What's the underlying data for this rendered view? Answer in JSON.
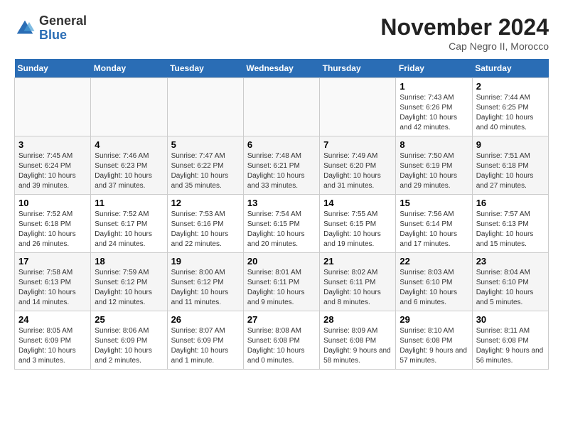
{
  "header": {
    "logo_general": "General",
    "logo_blue": "Blue",
    "month_title": "November 2024",
    "location": "Cap Negro II, Morocco"
  },
  "days_of_week": [
    "Sunday",
    "Monday",
    "Tuesday",
    "Wednesday",
    "Thursday",
    "Friday",
    "Saturday"
  ],
  "weeks": [
    [
      {
        "day": "",
        "info": ""
      },
      {
        "day": "",
        "info": ""
      },
      {
        "day": "",
        "info": ""
      },
      {
        "day": "",
        "info": ""
      },
      {
        "day": "",
        "info": ""
      },
      {
        "day": "1",
        "info": "Sunrise: 7:43 AM\nSunset: 6:26 PM\nDaylight: 10 hours and 42 minutes."
      },
      {
        "day": "2",
        "info": "Sunrise: 7:44 AM\nSunset: 6:25 PM\nDaylight: 10 hours and 40 minutes."
      }
    ],
    [
      {
        "day": "3",
        "info": "Sunrise: 7:45 AM\nSunset: 6:24 PM\nDaylight: 10 hours and 39 minutes."
      },
      {
        "day": "4",
        "info": "Sunrise: 7:46 AM\nSunset: 6:23 PM\nDaylight: 10 hours and 37 minutes."
      },
      {
        "day": "5",
        "info": "Sunrise: 7:47 AM\nSunset: 6:22 PM\nDaylight: 10 hours and 35 minutes."
      },
      {
        "day": "6",
        "info": "Sunrise: 7:48 AM\nSunset: 6:21 PM\nDaylight: 10 hours and 33 minutes."
      },
      {
        "day": "7",
        "info": "Sunrise: 7:49 AM\nSunset: 6:20 PM\nDaylight: 10 hours and 31 minutes."
      },
      {
        "day": "8",
        "info": "Sunrise: 7:50 AM\nSunset: 6:19 PM\nDaylight: 10 hours and 29 minutes."
      },
      {
        "day": "9",
        "info": "Sunrise: 7:51 AM\nSunset: 6:18 PM\nDaylight: 10 hours and 27 minutes."
      }
    ],
    [
      {
        "day": "10",
        "info": "Sunrise: 7:52 AM\nSunset: 6:18 PM\nDaylight: 10 hours and 26 minutes."
      },
      {
        "day": "11",
        "info": "Sunrise: 7:52 AM\nSunset: 6:17 PM\nDaylight: 10 hours and 24 minutes."
      },
      {
        "day": "12",
        "info": "Sunrise: 7:53 AM\nSunset: 6:16 PM\nDaylight: 10 hours and 22 minutes."
      },
      {
        "day": "13",
        "info": "Sunrise: 7:54 AM\nSunset: 6:15 PM\nDaylight: 10 hours and 20 minutes."
      },
      {
        "day": "14",
        "info": "Sunrise: 7:55 AM\nSunset: 6:15 PM\nDaylight: 10 hours and 19 minutes."
      },
      {
        "day": "15",
        "info": "Sunrise: 7:56 AM\nSunset: 6:14 PM\nDaylight: 10 hours and 17 minutes."
      },
      {
        "day": "16",
        "info": "Sunrise: 7:57 AM\nSunset: 6:13 PM\nDaylight: 10 hours and 15 minutes."
      }
    ],
    [
      {
        "day": "17",
        "info": "Sunrise: 7:58 AM\nSunset: 6:13 PM\nDaylight: 10 hours and 14 minutes."
      },
      {
        "day": "18",
        "info": "Sunrise: 7:59 AM\nSunset: 6:12 PM\nDaylight: 10 hours and 12 minutes."
      },
      {
        "day": "19",
        "info": "Sunrise: 8:00 AM\nSunset: 6:12 PM\nDaylight: 10 hours and 11 minutes."
      },
      {
        "day": "20",
        "info": "Sunrise: 8:01 AM\nSunset: 6:11 PM\nDaylight: 10 hours and 9 minutes."
      },
      {
        "day": "21",
        "info": "Sunrise: 8:02 AM\nSunset: 6:11 PM\nDaylight: 10 hours and 8 minutes."
      },
      {
        "day": "22",
        "info": "Sunrise: 8:03 AM\nSunset: 6:10 PM\nDaylight: 10 hours and 6 minutes."
      },
      {
        "day": "23",
        "info": "Sunrise: 8:04 AM\nSunset: 6:10 PM\nDaylight: 10 hours and 5 minutes."
      }
    ],
    [
      {
        "day": "24",
        "info": "Sunrise: 8:05 AM\nSunset: 6:09 PM\nDaylight: 10 hours and 3 minutes."
      },
      {
        "day": "25",
        "info": "Sunrise: 8:06 AM\nSunset: 6:09 PM\nDaylight: 10 hours and 2 minutes."
      },
      {
        "day": "26",
        "info": "Sunrise: 8:07 AM\nSunset: 6:09 PM\nDaylight: 10 hours and 1 minute."
      },
      {
        "day": "27",
        "info": "Sunrise: 8:08 AM\nSunset: 6:08 PM\nDaylight: 10 hours and 0 minutes."
      },
      {
        "day": "28",
        "info": "Sunrise: 8:09 AM\nSunset: 6:08 PM\nDaylight: 9 hours and 58 minutes."
      },
      {
        "day": "29",
        "info": "Sunrise: 8:10 AM\nSunset: 6:08 PM\nDaylight: 9 hours and 57 minutes."
      },
      {
        "day": "30",
        "info": "Sunrise: 8:11 AM\nSunset: 6:08 PM\nDaylight: 9 hours and 56 minutes."
      }
    ]
  ]
}
